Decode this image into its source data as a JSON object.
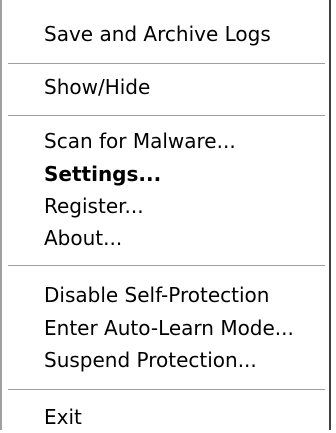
{
  "context_menu": {
    "items": [
      {
        "label": "Save and Archive Logs"
      },
      {
        "label": "Show/Hide"
      },
      {
        "label": "Scan for Malware..."
      },
      {
        "label": "Settings...",
        "bold": true
      },
      {
        "label": "Register..."
      },
      {
        "label": "About..."
      },
      {
        "label": "Disable Self-Protection"
      },
      {
        "label": "Enter Auto-Learn Mode..."
      },
      {
        "label": "Suspend Protection..."
      },
      {
        "label": "Exit"
      }
    ]
  },
  "colors": {
    "background": "#ffffff",
    "text": "#000000",
    "separator": "#a0a0a0"
  }
}
